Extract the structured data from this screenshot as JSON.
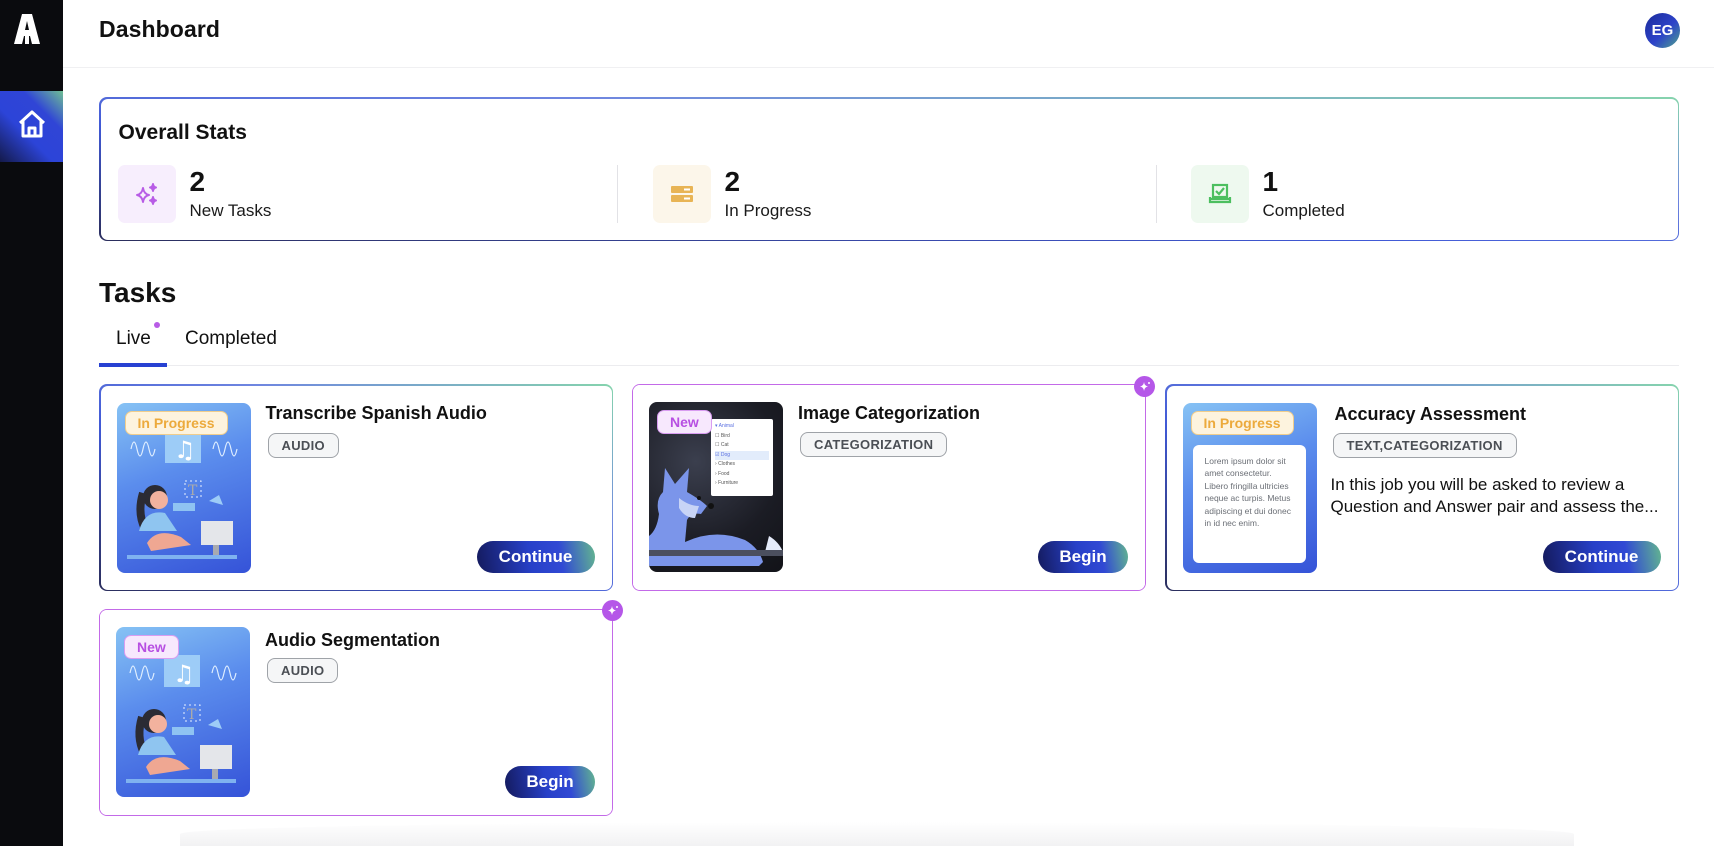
{
  "app": {
    "logo_icon": "brand-a-logo",
    "sidebar": {
      "items": [
        {
          "label": "Home",
          "icon": "home-icon",
          "active": true
        }
      ]
    }
  },
  "header": {
    "title": "Dashboard",
    "avatar_initials": "EG"
  },
  "stats": {
    "title": "Overall Stats",
    "items": [
      {
        "value": "2",
        "label": "New Tasks",
        "icon": "sparkles-icon",
        "color": "#b85ce6",
        "bg": "#f7eefd"
      },
      {
        "value": "2",
        "label": "In Progress",
        "icon": "stack-icon",
        "color": "#e8b455",
        "bg": "#fcf6ea"
      },
      {
        "value": "1",
        "label": "Completed",
        "icon": "inbox-check-icon",
        "color": "#4cbf5f",
        "bg": "#eef9ef"
      }
    ]
  },
  "tasks": {
    "title": "Tasks",
    "tabs": [
      {
        "label": "Live",
        "active": true,
        "has_dot": true
      },
      {
        "label": "Completed",
        "active": false
      }
    ],
    "cards": [
      {
        "title": "Transcribe Spanish Audio",
        "status": "In Progress",
        "tag": "AUDIO",
        "description": "",
        "action": "Continue",
        "image": "audio-illustration"
      },
      {
        "title": "Image Categorization",
        "status": "New",
        "tag": "CATEGORIZATION",
        "description": "",
        "action": "Begin",
        "image": "dog-categorization-illustration",
        "image_menu": [
          "Animal",
          "Bird",
          "Cat",
          "Dog",
          "Clothes",
          "Food",
          "Furniture"
        ]
      },
      {
        "title": "Accuracy Assessment",
        "status": "In Progress",
        "tag": "TEXT,CATEGORIZATION",
        "description": "In this job you will be asked to review a Question and Answer pair and assess the...",
        "action": "Continue",
        "image": "text-editor-illustration",
        "image_text": "Lorem ipsum dolor sit amet consectetur. Libero fringilla ultricies neque ac turpis. Metus adipiscing et dui donec in id nec enim."
      },
      {
        "title": "Audio Segmentation",
        "status": "New",
        "tag": "AUDIO",
        "description": "",
        "action": "Begin",
        "image": "audio-illustration"
      }
    ]
  }
}
